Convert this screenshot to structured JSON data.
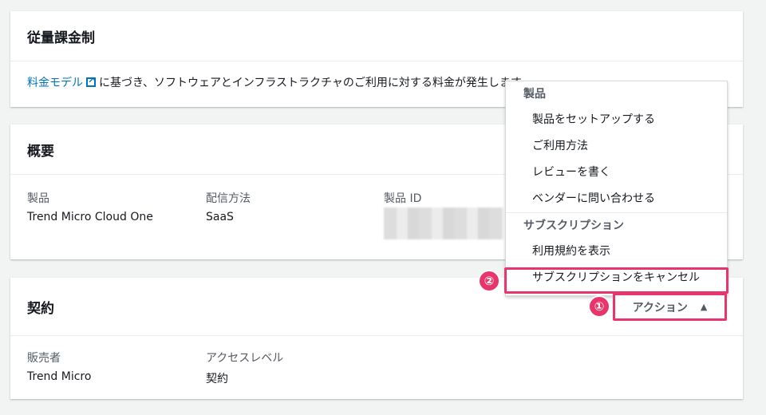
{
  "billing": {
    "title": "従量課金制",
    "link": "料金モデル",
    "text": "に基づき、ソフトウェアとインフラストラクチャのご利用に対する料金が発生します。"
  },
  "overview": {
    "title": "概要",
    "product_label": "製品",
    "product_value": "Trend Micro Cloud One",
    "delivery_label": "配信方法",
    "delivery_value": "SaaS",
    "id_label": "製品 ID"
  },
  "contract": {
    "title": "契約",
    "seller_label": "販売者",
    "seller_value": "Trend Micro",
    "access_label": "アクセスレベル",
    "access_value": "契約"
  },
  "menu": {
    "group1": "製品",
    "items1": [
      "製品をセットアップする",
      "ご利用方法",
      "レビューを書く",
      "ベンダーに問い合わせる"
    ],
    "group2": "サブスクリプション",
    "items2": [
      "利用規約を表示",
      "サブスクリプションをキャンセル"
    ]
  },
  "action": {
    "label": "アクション",
    "icon": "caret-up-icon"
  },
  "annotations": {
    "one": "①",
    "two": "②"
  },
  "colors": {
    "link": "#0073bb",
    "highlight": "#e8356b"
  }
}
